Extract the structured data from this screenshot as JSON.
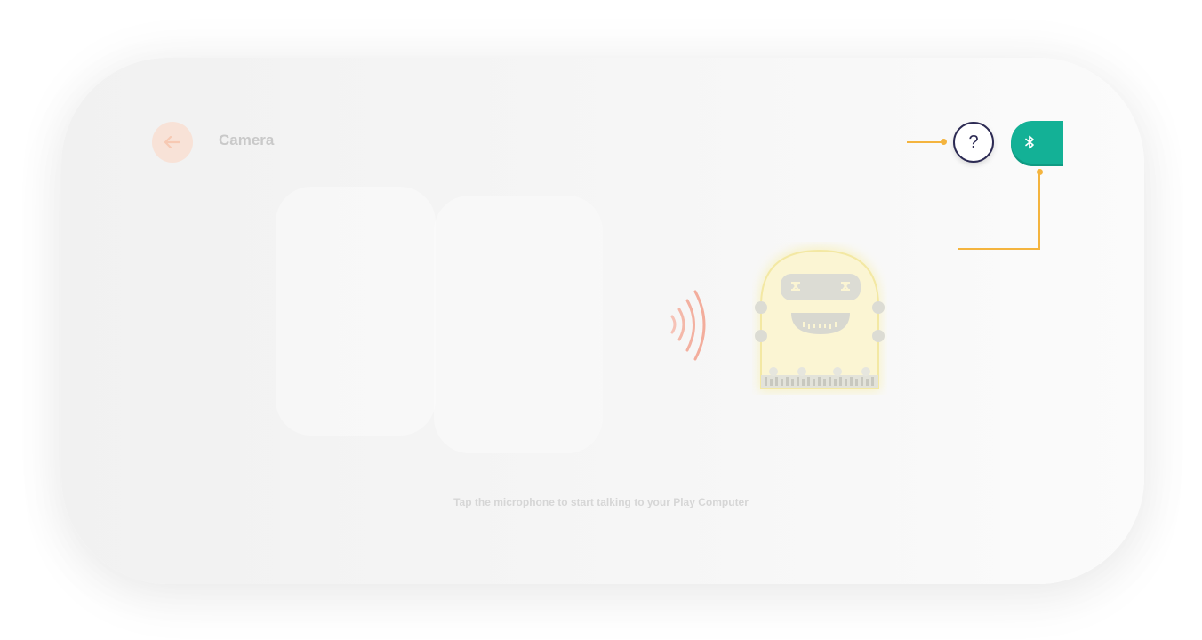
{
  "header": {
    "title": "Camera",
    "back_icon": "arrow-left-icon",
    "help_label": "?",
    "bluetooth_icon": "bluetooth-icon"
  },
  "main": {
    "hint": "Tap the microphone to start talking to your Play Computer",
    "robot_icon": "robot-board-icon",
    "signal_icon": "sound-waves-icon"
  },
  "colors": {
    "accent": "#f4b43e",
    "bluetooth": "#13b196",
    "help_border": "#2c2a53",
    "back_button": "#f8e2d7"
  }
}
